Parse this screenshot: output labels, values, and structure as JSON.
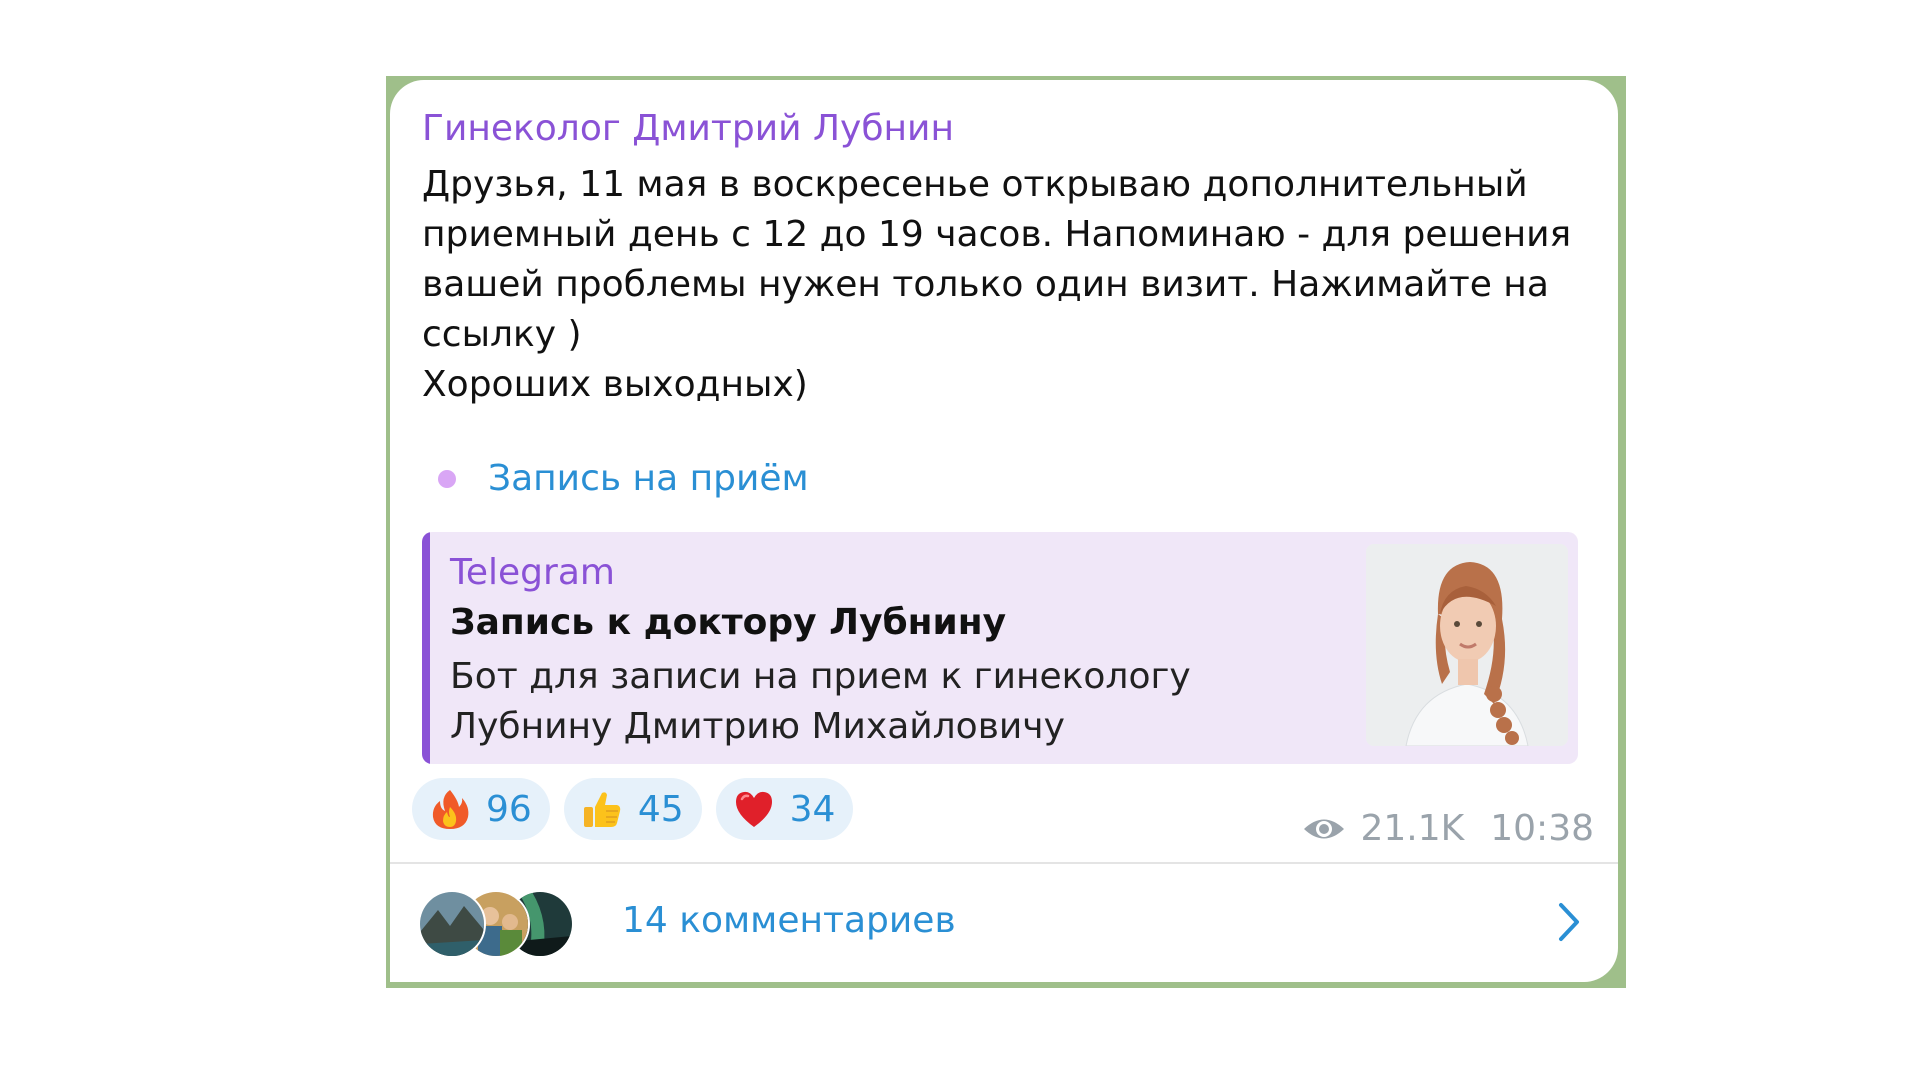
{
  "post": {
    "author": "Гинеколог Дмитрий Лубнин",
    "text": "Друзья, 11 мая в воскресенье открываю дополнительный приемный день с 12 до 19 часов. Напоминаю - для решения вашей проблемы нужен только один визит. Нажимайте на ссылку )\nХороших выходных)",
    "link_label": "Запись на приём"
  },
  "preview": {
    "site": "Telegram",
    "title": "Запись к доктору Лубнину",
    "description": "Бот для записи на прием к гинекологу Лубнину Дмитрию Михайловичу"
  },
  "reactions": [
    {
      "emoji": "fire-icon",
      "count": "96"
    },
    {
      "emoji": "thumbs-up-icon",
      "count": "45"
    },
    {
      "emoji": "heart-icon",
      "count": "34"
    }
  ],
  "meta": {
    "views": "21.1K",
    "time": "10:38"
  },
  "comments": {
    "label": "14 комментариев"
  },
  "colors": {
    "author": "#8a52d6",
    "link": "#2a8fd4",
    "preview_bg": "#f0e7f8",
    "reaction_bg": "#e6f1fa",
    "meta": "#9aa3ab",
    "chat_bg": "#9fbf8a"
  }
}
